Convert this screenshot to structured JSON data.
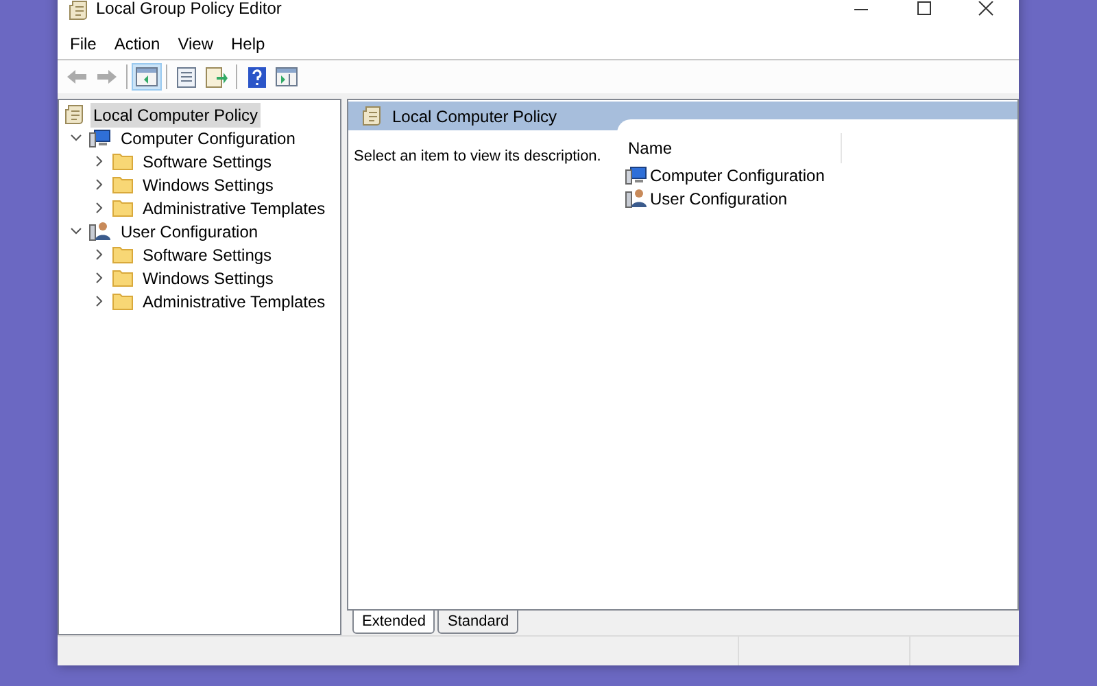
{
  "window": {
    "title": "Local Group Policy Editor"
  },
  "menu": [
    "File",
    "Action",
    "View",
    "Help"
  ],
  "toolbar": [
    {
      "kind": "back",
      "disabled": true,
      "selected": false
    },
    {
      "kind": "forward",
      "disabled": true,
      "selected": false
    },
    {
      "kind": "tree",
      "disabled": false,
      "selected": true
    },
    {
      "kind": "properties",
      "disabled": false,
      "selected": false
    },
    {
      "kind": "export",
      "disabled": false,
      "selected": false
    },
    {
      "kind": "help",
      "disabled": false,
      "selected": false
    },
    {
      "kind": "pane",
      "disabled": false,
      "selected": false
    }
  ],
  "tree": [
    {
      "label": "Local Computer Policy",
      "kind": "policy",
      "selected": true,
      "children": [
        {
          "label": "Computer Configuration",
          "kind": "computer",
          "expanded": true,
          "selected": false,
          "children": [
            {
              "label": "Software Settings",
              "kind": "folder",
              "expanded": false,
              "selected": false
            },
            {
              "label": "Windows Settings",
              "kind": "folder",
              "expanded": false,
              "selected": false
            },
            {
              "label": "Administrative Templates",
              "kind": "folder",
              "expanded": false,
              "selected": false
            }
          ]
        },
        {
          "label": "User Configuration",
          "kind": "user",
          "expanded": true,
          "selected": false,
          "children": [
            {
              "label": "Software Settings",
              "kind": "folder",
              "expanded": false,
              "selected": false
            },
            {
              "label": "Windows Settings",
              "kind": "folder",
              "expanded": false,
              "selected": false
            },
            {
              "label": "Administrative Templates",
              "kind": "folder",
              "expanded": false,
              "selected": false
            }
          ]
        }
      ]
    }
  ],
  "details": {
    "header": "Local Computer Policy",
    "description": "Select an item to view its description.",
    "column": "Name",
    "items": [
      {
        "label": "Computer Configuration",
        "kind": "computer"
      },
      {
        "label": "User Configuration",
        "kind": "user"
      }
    ]
  },
  "tabs": [
    {
      "label": "Extended",
      "selected": true
    },
    {
      "label": "Standard",
      "selected": false
    }
  ]
}
